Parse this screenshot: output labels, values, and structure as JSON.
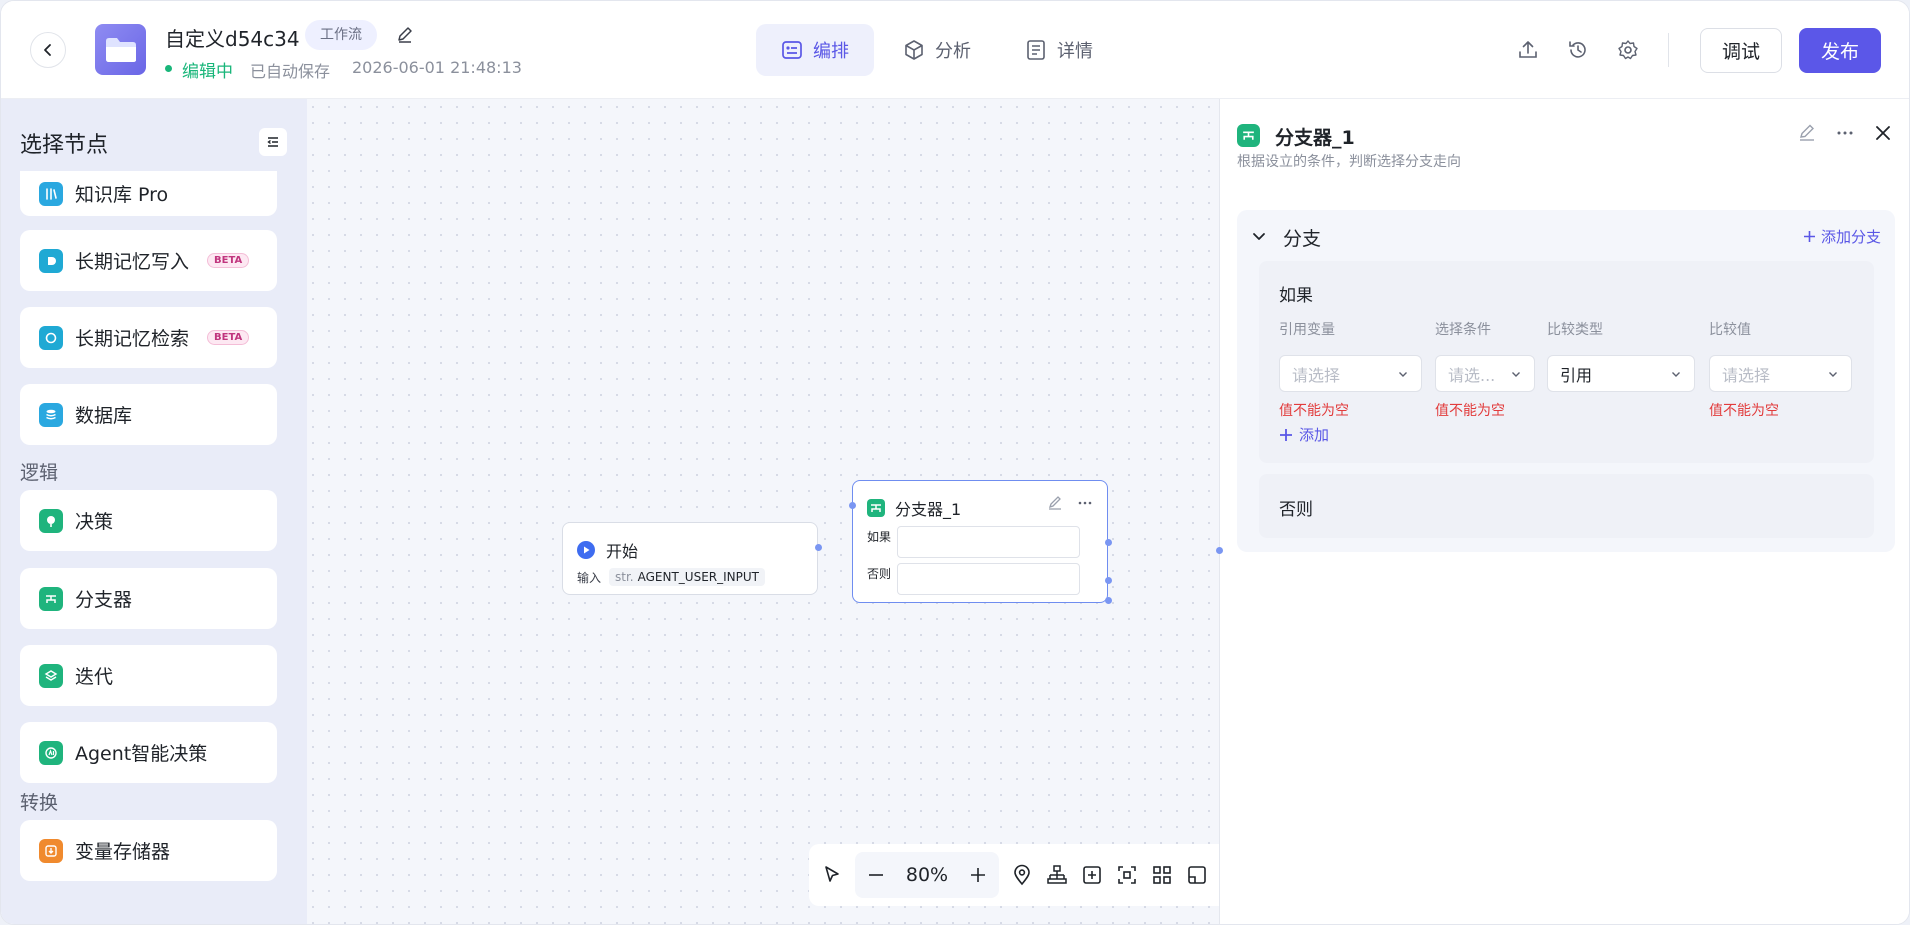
{
  "header": {
    "title": "自定义d54c34",
    "tag": "工作流",
    "status": "编辑中",
    "autosave": "已自动保存",
    "save_time": "2026-06-01 21:48:13",
    "tabs": [
      {
        "label": "编排",
        "active": true
      },
      {
        "label": "分析",
        "active": false
      },
      {
        "label": "详情",
        "active": false
      }
    ],
    "debug_label": "调试",
    "publish_label": "发布",
    "accent": "#5b57e8"
  },
  "sidebar": {
    "title": "选择节点",
    "items": [
      {
        "label": "知识库 Pro",
        "icon": "knowledge-icon"
      },
      {
        "label": "长期记忆写入",
        "icon": "memory-write-icon",
        "badge": "BETA"
      },
      {
        "label": "长期记忆检索",
        "icon": "memory-search-icon",
        "badge": "BETA"
      },
      {
        "label": "数据库",
        "icon": "database-icon"
      }
    ],
    "section_logic": "逻辑",
    "logic_items": [
      {
        "label": "决策",
        "icon": "decision-icon"
      },
      {
        "label": "分支器",
        "icon": "branch-icon"
      },
      {
        "label": "迭代",
        "icon": "iteration-icon"
      },
      {
        "label": "Agent智能决策",
        "icon": "agent-icon"
      }
    ],
    "section_transform": "转换",
    "transform_items": [
      {
        "label": "变量存储器",
        "icon": "variable-store-icon"
      }
    ]
  },
  "canvas": {
    "start_node": {
      "title": "开始",
      "input_label": "输入",
      "var_type": "str.",
      "var_name": "AGENT_USER_INPUT"
    },
    "branch_node": {
      "title": "分支器_1",
      "if_label": "如果",
      "else_label": "否则"
    },
    "zoom": "80%"
  },
  "panel": {
    "title": "分支器_1",
    "subtitle": "根据设立的条件，判断选择分支走向",
    "section_title": "分支",
    "add_branch": "添加分支",
    "if_title": "如果",
    "columns": [
      "引用变量",
      "选择条件",
      "比较类型",
      "比较值"
    ],
    "selects": [
      "请选择",
      "请选...",
      "引用",
      "请选择"
    ],
    "errors": [
      "值不能为空",
      "值不能为空",
      "值不能为空"
    ],
    "add_condition": "添加",
    "else_title": "否则"
  }
}
